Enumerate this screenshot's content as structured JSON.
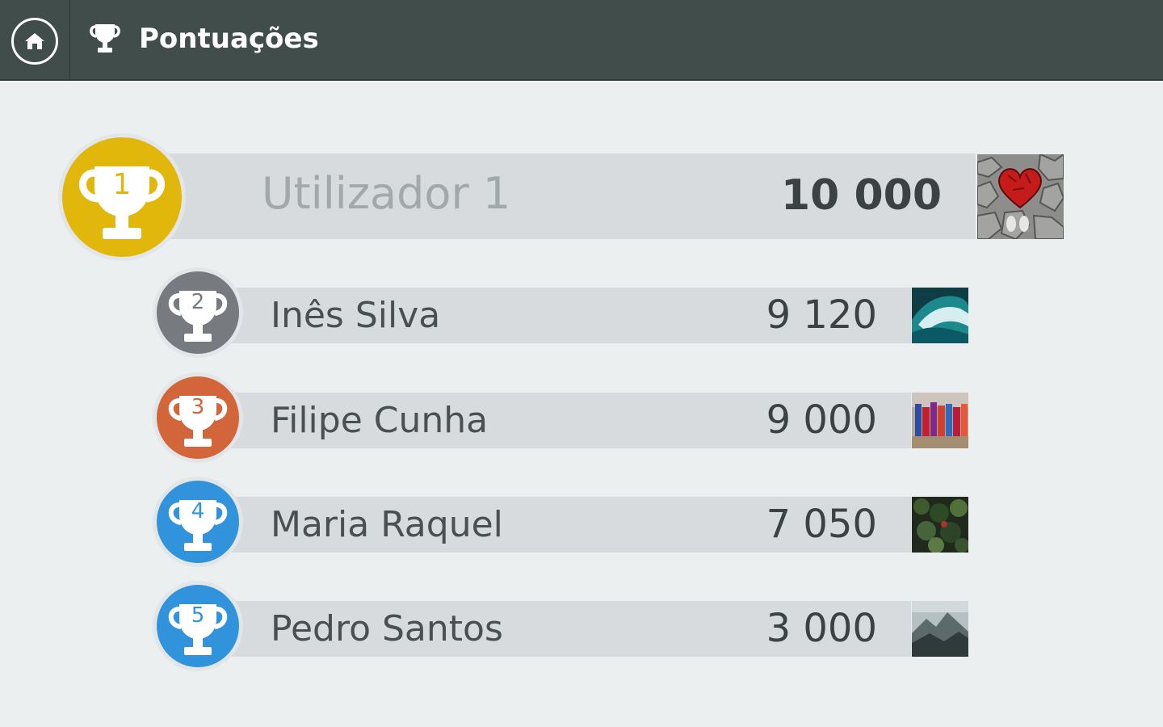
{
  "header": {
    "title": "Pontuações",
    "home_icon": "home-icon",
    "title_icon": "trophy-icon",
    "background": "#414d4a"
  },
  "leaderboard": [
    {
      "rank": "1",
      "name": "Utilizador 1",
      "score": "10 000",
      "badge_color": "#e2b70c",
      "avatar": "heart-stones-photo"
    },
    {
      "rank": "2",
      "name": "Inês Silva",
      "score": "9 120",
      "badge_color": "#777b7f",
      "avatar": "wave-photo"
    },
    {
      "rank": "3",
      "name": "Filipe Cunha",
      "score": "9 000",
      "badge_color": "#d2653a",
      "avatar": "crowd-photo"
    },
    {
      "rank": "4",
      "name": "Maria Raquel",
      "score": "7 050",
      "badge_color": "#3193db",
      "avatar": "forest-photo"
    },
    {
      "rank": "5",
      "name": "Pedro Santos",
      "score": "3 000",
      "badge_color": "#3193db",
      "avatar": "misty-mountain-photo"
    }
  ]
}
